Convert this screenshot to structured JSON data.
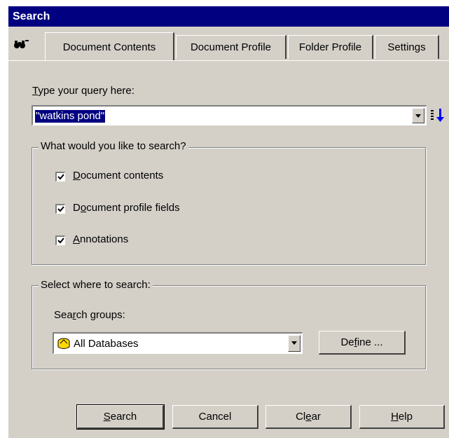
{
  "window": {
    "title": "Search"
  },
  "tabs": [
    {
      "label": "Document Contents",
      "active": true
    },
    {
      "label": "Document Profile",
      "active": false
    },
    {
      "label": "Folder Profile",
      "active": false
    },
    {
      "label": "Settings",
      "active": false
    }
  ],
  "query": {
    "label_hotkey": "T",
    "label_rest": "ype your query here:",
    "value": "\"watkins pond\""
  },
  "search_what": {
    "legend": "What would you like to search?",
    "options": [
      {
        "hotkey": "D",
        "rest": "ocument contents",
        "checked": true
      },
      {
        "pre": "D",
        "hotkey": "o",
        "rest": "cument profile fields",
        "checked": true
      },
      {
        "hotkey": "A",
        "rest": "nnotations",
        "checked": true
      }
    ]
  },
  "search_where": {
    "legend": "Select where to search:",
    "groups_pre": "Sea",
    "groups_hotkey": "r",
    "groups_rest": "ch groups:",
    "selected": "All Databases",
    "define_pre": "De",
    "define_hotkey": "f",
    "define_rest": "ine ..."
  },
  "buttons": {
    "search": {
      "hotkey": "S",
      "rest": "earch"
    },
    "cancel": "Cancel",
    "clear": {
      "pre": "Cl",
      "hotkey": "e",
      "rest": "ar"
    },
    "help": {
      "hotkey": "H",
      "rest": "elp"
    }
  },
  "icons": {
    "binoculars": "binoculars-icon",
    "sort": "sort-descending-icon",
    "database": "database-icon"
  }
}
